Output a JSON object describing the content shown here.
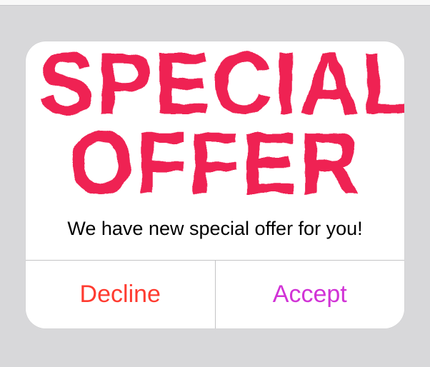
{
  "dialog": {
    "headline_line1": "SPECIAL",
    "headline_line2": "OFFER",
    "subtitle": "We have new special offer for you!",
    "decline_label": "Decline",
    "accept_label": "Accept"
  },
  "colors": {
    "headline": "#ef2353",
    "decline": "#ff3b30",
    "accept": "#d133d6"
  }
}
